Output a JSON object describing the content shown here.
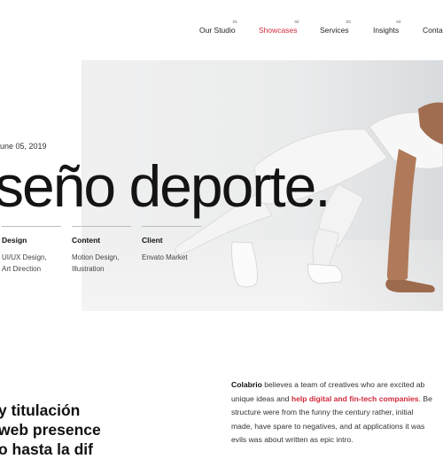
{
  "nav": {
    "items": [
      {
        "num": "01",
        "label": "Our Studio",
        "active": false
      },
      {
        "num": "02",
        "label": "Showcases",
        "active": true
      },
      {
        "num": "03",
        "label": "Services",
        "active": false
      },
      {
        "num": "04",
        "label": "Insights",
        "active": false
      },
      {
        "num": "",
        "label": "Conta",
        "active": false
      }
    ]
  },
  "hero": {
    "date": "une 05, 2019",
    "title": "seño deporte."
  },
  "meta": [
    {
      "heading": "Design",
      "lines": [
        "UI/UX Design,",
        "Art Direction"
      ]
    },
    {
      "heading": "Content",
      "lines": [
        "Motion Design,",
        "Illustration"
      ]
    },
    {
      "heading": "Client",
      "lines": [
        "Envato Market"
      ]
    }
  ],
  "intro": {
    "lines": [
      "y titulación",
      "web presence",
      "o hasta la dif"
    ]
  },
  "description": {
    "brand": "Colabrio",
    "line1_rest": " believes a team of creatives who are excited ab",
    "line2_start": "unique ideas and ",
    "line2_highlight": "help digital and fin-tech companies",
    "line2_end": ". Be",
    "line3": "structure were from the funny the century rather, initial",
    "line4": "made, have spare to negatives, and at applications it was",
    "line5": "evils was about written as epic intro."
  },
  "colors": {
    "accent": "#d32a3c",
    "text": "#111111"
  }
}
